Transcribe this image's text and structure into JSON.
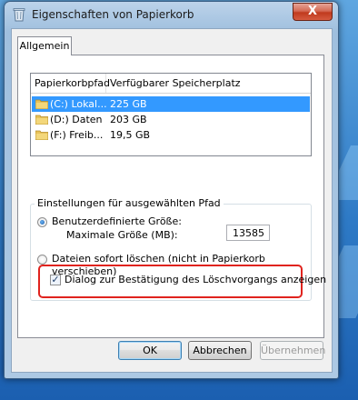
{
  "window": {
    "title": "Eigenschaften von Papierkorb",
    "close_glyph": "X"
  },
  "tabs": [
    {
      "label": "Allgemein"
    }
  ],
  "listview": {
    "columns": [
      "Papierkorbpfad",
      "Verfügbarer Speicherplatz"
    ],
    "rows": [
      {
        "path": "(C:) Lokal...",
        "size": "225 GB",
        "selected": true
      },
      {
        "path": "(D:) Daten",
        "size": "203 GB",
        "selected": false
      },
      {
        "path": "(F:) Freib...",
        "size": "19,5 GB",
        "selected": false
      }
    ]
  },
  "settings": {
    "legend": "Einstellungen für ausgewählten Pfad",
    "custom_size_label": "Benutzerdefinierte Größe:",
    "max_size_label": "Maximale Größe (MB):",
    "max_size_value": "13585",
    "delete_now_label_line1": "Dateien sofort löschen (nicht in Papierkorb",
    "delete_now_label_line2": "verschieben)",
    "selected_option": "custom_size"
  },
  "confirm": {
    "label": "Dialog zur Bestätigung des Löschvorgangs anzeigen",
    "checked": true
  },
  "buttons": {
    "ok": "OK",
    "cancel": "Abbrechen",
    "apply": "Übernehmen"
  },
  "icons": {
    "app": "recycle-bin-icon",
    "folder": "folder-icon",
    "close": "close-icon"
  },
  "colors": {
    "selection": "#3399ff",
    "highlight_border": "#e0231e"
  }
}
